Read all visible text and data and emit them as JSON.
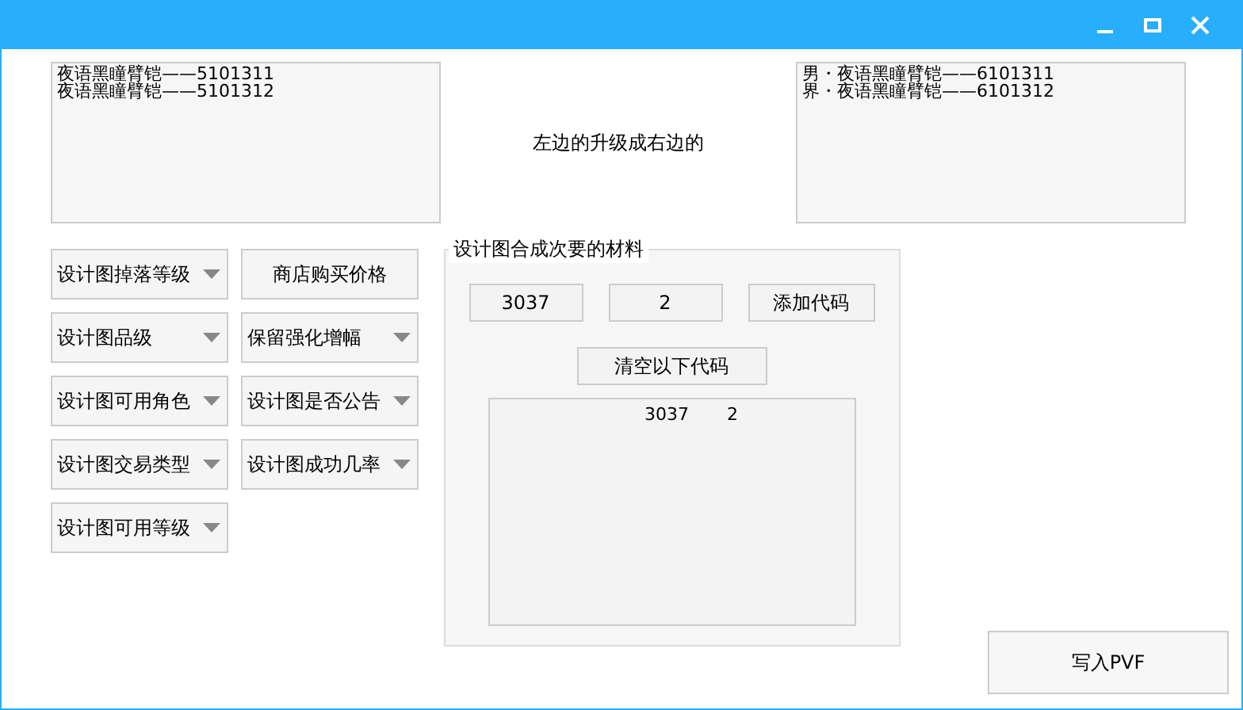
{
  "left_list": {
    "lines": [
      "夜语黑瞳臂铠——5101311",
      "夜语黑瞳臂铠——5101312"
    ]
  },
  "center_label": "左边的升级成右边的",
  "right_list": {
    "lines": [
      "男・夜语黑瞳臂铠——6101311",
      "界・夜语黑瞳臂铠——6101312"
    ]
  },
  "controls": [
    {
      "kind": "dropdown",
      "label": "设计图掉落等级"
    },
    {
      "kind": "button",
      "label": "商店购买价格"
    },
    {
      "kind": "dropdown",
      "label": "设计图品级"
    },
    {
      "kind": "dropdown",
      "label": "保留强化增幅"
    },
    {
      "kind": "dropdown",
      "label": "设计图可用角色"
    },
    {
      "kind": "dropdown",
      "label": "设计图是否公告"
    },
    {
      "kind": "dropdown",
      "label": "设计图交易类型"
    },
    {
      "kind": "dropdown",
      "label": "设计图成功几率"
    },
    {
      "kind": "dropdown",
      "label": "设计图可用等级"
    }
  ],
  "materials": {
    "title": "设计图合成次要的材料",
    "code_value": "3037",
    "count_value": "2",
    "add_button": "添加代码",
    "clear_button": "清空以下代码",
    "output_rows": [
      [
        "3037",
        "2"
      ]
    ]
  },
  "write_button": "写入PVF"
}
